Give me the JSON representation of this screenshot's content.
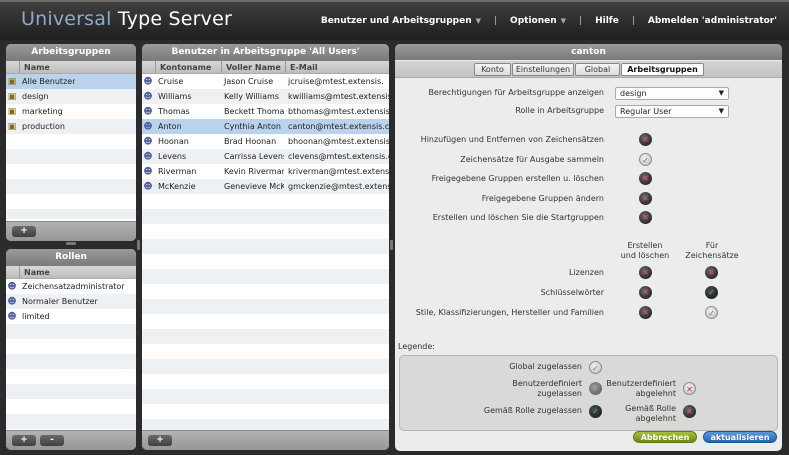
{
  "header": {
    "logo_part1": "Universal",
    "logo_part2": "Type Server",
    "nav": {
      "users_groups": "Benutzer und Arbeitsgruppen",
      "options": "Optionen",
      "help": "Hilfe",
      "logout": "Abmelden 'administrator'"
    }
  },
  "workgroups": {
    "title": "Arbeitsgruppen",
    "column_name": "Name",
    "items": [
      {
        "name": "Alle Benutzer",
        "selected": true
      },
      {
        "name": "design",
        "selected": false
      },
      {
        "name": "marketing",
        "selected": false
      },
      {
        "name": "production",
        "selected": false
      }
    ],
    "add_label": "+"
  },
  "roles": {
    "title": "Rollen",
    "column_name": "Name",
    "items": [
      {
        "name": "Zeichensatzadministrator",
        "icon": "admin-user-icon"
      },
      {
        "name": "Normaler Benutzer",
        "icon": "user-icon"
      },
      {
        "name": "limited",
        "icon": "limited-user-icon"
      }
    ],
    "add_label": "+",
    "remove_label": "-"
  },
  "users": {
    "title": "Benutzer in Arbeitsgruppe 'All Users'",
    "columns": [
      "Kontoname",
      "Voller Name",
      "E-Mail"
    ],
    "rows": [
      {
        "account": "Cruise",
        "fullname": "Jason Cruise",
        "email": "jcruise@mtest.extensis.",
        "selected": false
      },
      {
        "account": "Williams",
        "fullname": "Kelly Williams",
        "email": "kwilliams@mtest.extensis",
        "selected": false
      },
      {
        "account": "Thomas",
        "fullname": "Beckett Thomas",
        "email": "bthomas@mtest.extensis",
        "selected": false
      },
      {
        "account": "Anton",
        "fullname": "Cynthia Anton",
        "email": "canton@mtest.extensis.c",
        "selected": true
      },
      {
        "account": "Hoonan",
        "fullname": "Brad Hoonan",
        "email": "bhoonan@mtest.extensis.",
        "selected": false
      },
      {
        "account": "Levens",
        "fullname": "Carrissa Levens",
        "email": "clevens@mtest.extensis.c",
        "selected": false
      },
      {
        "account": "Riverman",
        "fullname": "Kevin Riverman",
        "email": "kriverman@mtest.extensi",
        "selected": false
      },
      {
        "account": "McKenzie",
        "fullname": "Genevieve McKe",
        "email": "gmckenzie@mtest.extensi",
        "selected": false
      }
    ],
    "add_label": "+"
  },
  "detail": {
    "title": "canton",
    "tabs": [
      {
        "label": "Konto",
        "active": false
      },
      {
        "label": "Einstellungen",
        "active": false
      },
      {
        "label": "Global",
        "active": false
      },
      {
        "label": "Arbeitsgruppen",
        "active": true
      }
    ],
    "perm_view_label": "Berechtigungen für Arbeitsgruppe anzeigen",
    "perm_view_value": "design",
    "role_label": "Rolle in Arbeitsgruppe",
    "role_value": "Regular User",
    "permissions": [
      {
        "label": "Hinzufügen und Entfernen von Zeichensätzen",
        "state": "denied"
      },
      {
        "label": "Zeichensätze für Ausgabe sammeln",
        "state": "inherited-global"
      },
      {
        "label": "Freigegebene Gruppen erstellen u. löschen",
        "state": "denied"
      },
      {
        "label": "Freigegebene Gruppen ändern",
        "state": "denied"
      },
      {
        "label": "Erstellen und löschen Sie die Startgruppen",
        "state": "denied"
      }
    ],
    "col_create_delete": "Erstellen und löschen",
    "col_for_fonts": "Für Zeichensätze",
    "metadata": [
      {
        "label": "Lizenzen",
        "create": "denied",
        "fonts": "denied"
      },
      {
        "label": "Schlüsselwörter",
        "create": "denied",
        "fonts": "granted"
      },
      {
        "label": "Stile, Klassifizierungen, Hersteller und Familien",
        "create": "denied",
        "fonts": "inherited-global"
      }
    ],
    "legend_title": "Legende:",
    "legend": {
      "global_allowed": "Global zugelassen",
      "user_allowed_line1": "Benutzerdefiniert",
      "user_allowed_line2": "zugelassen",
      "user_denied_line1": "Benutzerdefiniert",
      "user_denied_line2": "abgelehnt",
      "role_allowed": "Gemäß Rolle zugelassen",
      "role_denied_line1": "Gemäß Rolle",
      "role_denied_line2": "abgelehnt"
    },
    "cancel_label": "Abbrechen",
    "update_label": "aktualisieren"
  },
  "colors": {
    "accent_selected": "#b9d3ec",
    "cancel_button": "#8aa51d",
    "update_button": "#3a78c3",
    "logo_light": "#8fa9cc"
  }
}
